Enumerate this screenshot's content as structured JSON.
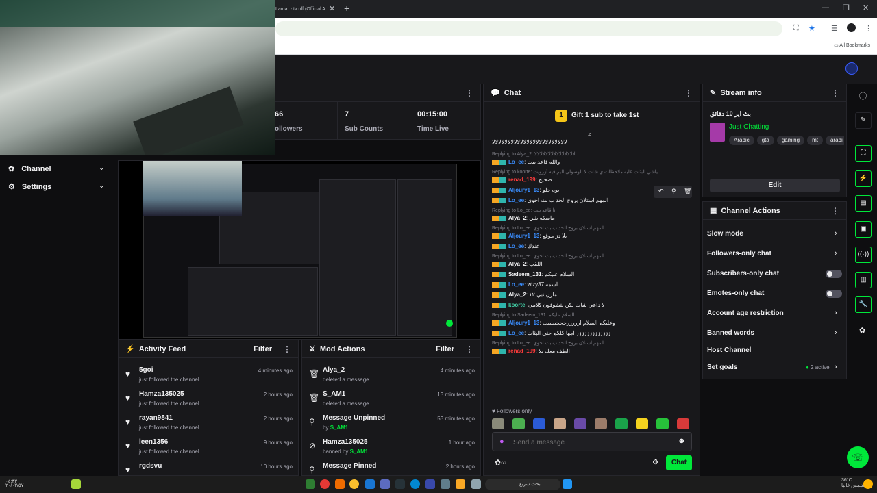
{
  "browser": {
    "tab_title": "Lamar - tv off (Official A...",
    "bookmarks_label": "All Bookmarks"
  },
  "stats": [
    {
      "value": "66",
      "label": "ollowers"
    },
    {
      "value": "7",
      "label": "Sub Counts"
    },
    {
      "value": "00:15:00",
      "label": "Time Live"
    }
  ],
  "sidebar": {
    "items": [
      {
        "label": "Channel"
      },
      {
        "label": "Settings"
      }
    ]
  },
  "activity_feed": {
    "title": "Activity Feed",
    "filter_label": "Filter",
    "rows": [
      {
        "name": "5goi",
        "action": "just followed the channel",
        "time": "4 minutes ago"
      },
      {
        "name": "Hamza135025",
        "action": "just followed the channel",
        "time": "2 hours ago"
      },
      {
        "name": "rayan9841",
        "action": "just followed the channel",
        "time": "2 hours ago"
      },
      {
        "name": "leen1356",
        "action": "just followed the channel",
        "time": "9 hours ago"
      },
      {
        "name": "rgdsvu",
        "action": "",
        "time": "10 hours ago"
      }
    ]
  },
  "mod_actions": {
    "title": "Mod Actions",
    "filter_label": "Filter",
    "rows": [
      {
        "name": "Alya_2",
        "action": "deleted a message",
        "by": "",
        "time": "4 minutes ago"
      },
      {
        "name": "S_AM1",
        "action": "deleted a message",
        "by": "",
        "time": "13 minutes ago"
      },
      {
        "name": "Message Unpinned",
        "action": "by",
        "by": "S_AM1",
        "time": "53 minutes ago"
      },
      {
        "name": "Hamza135025",
        "action": "banned by",
        "by": "S_AM1",
        "time": "1 hour ago"
      },
      {
        "name": "Message Pinned",
        "action": "",
        "by": "",
        "time": "2 hours ago"
      }
    ]
  },
  "chat": {
    "title": "Chat",
    "gift_banner": "Gift 1 sub to take 1st",
    "gift_count": "1",
    "top_message": "ﻻﻻﻻﻻﻻﻻﻻﻻﻻﻻﻻﻻﻻﻻﻻﻻﻻﻻﻻﻻﻻﻻﻻﻻ",
    "messages": [
      {
        "reply": "Replying to Alya_2: ﻻﻻﻻﻻﻻﻻﻻﻻﻻﻻﻻﻻﻻﻻﻻ",
        "user": "Lo_ee",
        "color": "blue",
        "text": "والله قاعد بيت"
      },
      {
        "reply": "Replying to koorte: ياشي البثات عليه ملاحظات ي شات لا الوصولي اليم فيه أزرويت",
        "user": "renad_199",
        "color": "red",
        "text": "صحيح"
      },
      {
        "reply": "",
        "user": "Aljoury1_13",
        "color": "blue",
        "text": "ايوه حلو"
      },
      {
        "reply": "",
        "user": "Lo_ee",
        "color": "blue",
        "text": "المهم استلان بروح الحد ب بث اخوي"
      },
      {
        "reply": "Replying to Lo_ee: انا قاعد بيت",
        "user": "Alya_2",
        "color": "white",
        "text": "ماسكه بثين"
      },
      {
        "reply": "Replying to Lo_ee: المهم استلان بروح الحد ب بث اخوي",
        "user": "Aljoury1_13",
        "color": "blue",
        "text": "يلا دز موقع"
      },
      {
        "reply": "",
        "user": "Lo_ee",
        "color": "blue",
        "text": "عندك"
      },
      {
        "reply": "Replying to Lo_ee: المهم استلان بروح الحد ب بث اخوي",
        "user": "Alya_2",
        "color": "white",
        "text": "اللقب"
      },
      {
        "reply": "",
        "user": "Sadeem_131",
        "color": "white",
        "text": "السلام عليكم"
      },
      {
        "reply": "",
        "user": "Lo_ee",
        "color": "blue",
        "text": "wizy37 اسمه"
      },
      {
        "reply": "",
        "user": "Alya_2",
        "color": "white",
        "text": "مازن نبي ١٢"
      },
      {
        "reply": "",
        "user": "koorte",
        "color": "green",
        "text": "لا داعي شات لكن بتشوفون كلامي"
      },
      {
        "reply": "Replying to Sadeem_131: السلام عليكم",
        "user": "Aljoury1_13",
        "color": "blue",
        "text": "وعليكم السلام ارررررحححيييييب"
      },
      {
        "reply": "",
        "user": "Lo_ee",
        "color": "blue",
        "text": "ززززززززززززز امها كلكم حتى البثات"
      },
      {
        "reply": "Replying to Lo_ee: المهم استلان بروح الحد ب بث اخوي",
        "user": "renad_199",
        "color": "red",
        "text": "الطف معك يلا"
      }
    ],
    "followers_only_label": "Followers only",
    "input_placeholder": "Send a message",
    "chat_button": "Chat"
  },
  "stream_info": {
    "title": "Stream info",
    "stream_title": "بث اير 10 دقائق",
    "category": "Just Chatting",
    "tags": [
      "Arabic",
      "gta",
      "gaming",
      "mt",
      "arabi"
    ],
    "edit_label": "Edit"
  },
  "channel_actions": {
    "title": "Channel Actions",
    "items": [
      {
        "label": "Slow mode",
        "kind": "chevron"
      },
      {
        "label": "Followers-only chat",
        "kind": "chevron"
      },
      {
        "label": "Subscribers-only chat",
        "kind": "toggle"
      },
      {
        "label": "Emotes-only chat",
        "kind": "toggle"
      },
      {
        "label": "Account age restriction",
        "kind": "chevron"
      },
      {
        "label": "Banned words",
        "kind": "chevron"
      },
      {
        "label": "Host Channel",
        "kind": "none"
      },
      {
        "label": "Set goals",
        "kind": "chevron"
      }
    ],
    "goals_status": "2 active"
  },
  "taskbar": {
    "search_placeholder": "بحث سريع",
    "clock_time": "٠٤:٣٣",
    "clock_date": "٢٠/٠٣/٥٧",
    "weather": "36°C",
    "weather_desc": "مشمس غالبا"
  },
  "colors": {
    "accent": "#00e83a",
    "panel": "#18181b",
    "background": "#0e0e10",
    "link_blue": "#3a8eff",
    "gift_gold": "#f5c518"
  }
}
